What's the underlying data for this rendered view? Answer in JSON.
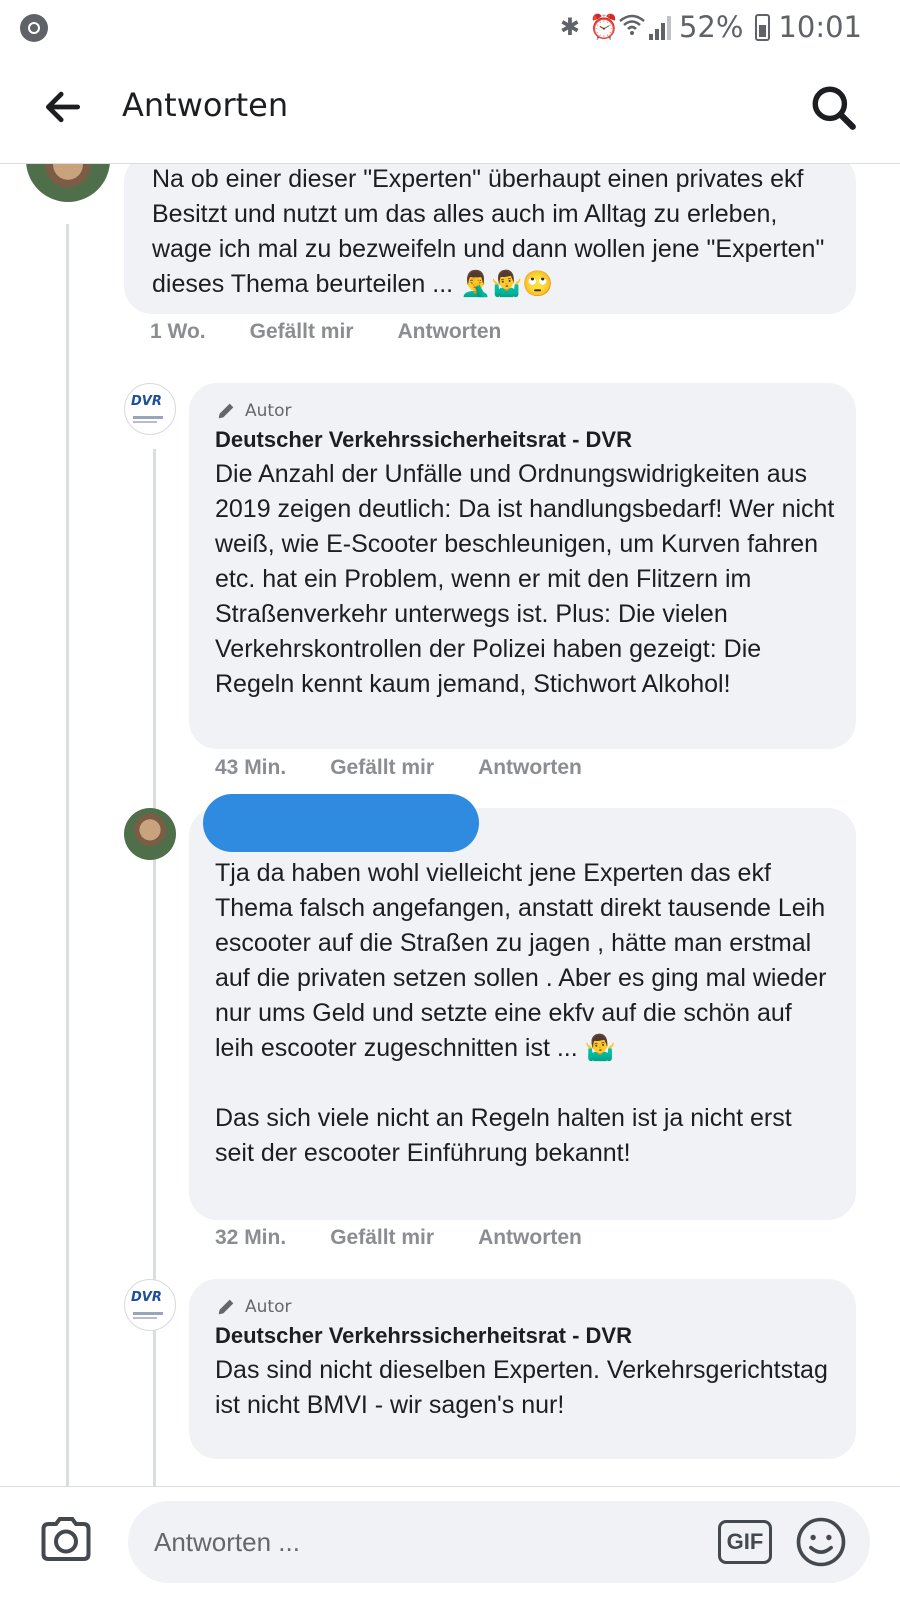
{
  "status_bar": {
    "battery": "52%",
    "time": "10:01",
    "icons": [
      "app-icon",
      "bluetooth-icon",
      "alarm-icon",
      "wifi-icon",
      "signal-icon",
      "battery-icon"
    ]
  },
  "header": {
    "title": "Antworten",
    "back_icon": "back-arrow-icon",
    "search_icon": "search-icon"
  },
  "comments": [
    {
      "text": "Na ob einer dieser \"Experten\" überhaupt einen privates ekf Besitzt und nutzt um das alles auch im Alltag zu erleben,  wage ich mal zu bezweifeln und dann wollen jene \"Experten\" dieses Thema beurteilen ... 🤦‍♂️🤷‍♂️🙄",
      "time": "1 Wo.",
      "like": "Gefällt mir",
      "reply": "Antworten"
    },
    {
      "badge": "Autor",
      "author": "Deutscher Verkehrssicherheitsrat - DVR",
      "text": "Die Anzahl der Unfälle und Ordnungswidrigkeiten aus 2019 zeigen deutlich: Da ist handlungsbedarf! Wer nicht weiß, wie E-Scooter beschleunigen, um Kurven fahren etc. hat ein Problem, wenn er mit den Flitzern im Straßenverkehr unterwegs ist. Plus: Die vielen Verkehrskontrollen der Polizei haben gezeigt: Die Regeln kennt kaum jemand, Stichwort Alkohol!",
      "time": "43 Min.",
      "like": "Gefällt mir",
      "reply": "Antworten"
    },
    {
      "text": "Tja da haben wohl vielleicht jene Experten das ekf Thema falsch angefangen, anstatt direkt tausende Leih escooter auf die Straßen zu jagen , hätte man erstmal auf die privaten setzen sollen . Aber es ging mal wieder nur ums Geld und setzte eine ekfv auf die schön auf leih escooter zugeschnitten ist ... 🤷‍♂️\n\nDas sich viele nicht an Regeln halten ist ja nicht erst seit der escooter Einführung bekannt!",
      "time": "32 Min.",
      "like": "Gefällt mir",
      "reply": "Antworten"
    },
    {
      "badge": "Autor",
      "author": "Deutscher Verkehrssicherheitsrat - DVR",
      "text": "Das sind nicht dieselben Experten. Verkehrsgerichtstag ist nicht BMVI - wir sagen's nur!"
    }
  ],
  "dvr_logo_text": "DVR",
  "composer": {
    "placeholder": "Antworten ...",
    "gif_label": "GIF",
    "camera_icon": "camera-icon",
    "emoji_icon": "emoji-icon"
  },
  "colors": {
    "bubble": "#f0f2f5",
    "meta_text": "#8a8d91",
    "redaction": "#2f8be0",
    "text": "#1c1e21"
  }
}
